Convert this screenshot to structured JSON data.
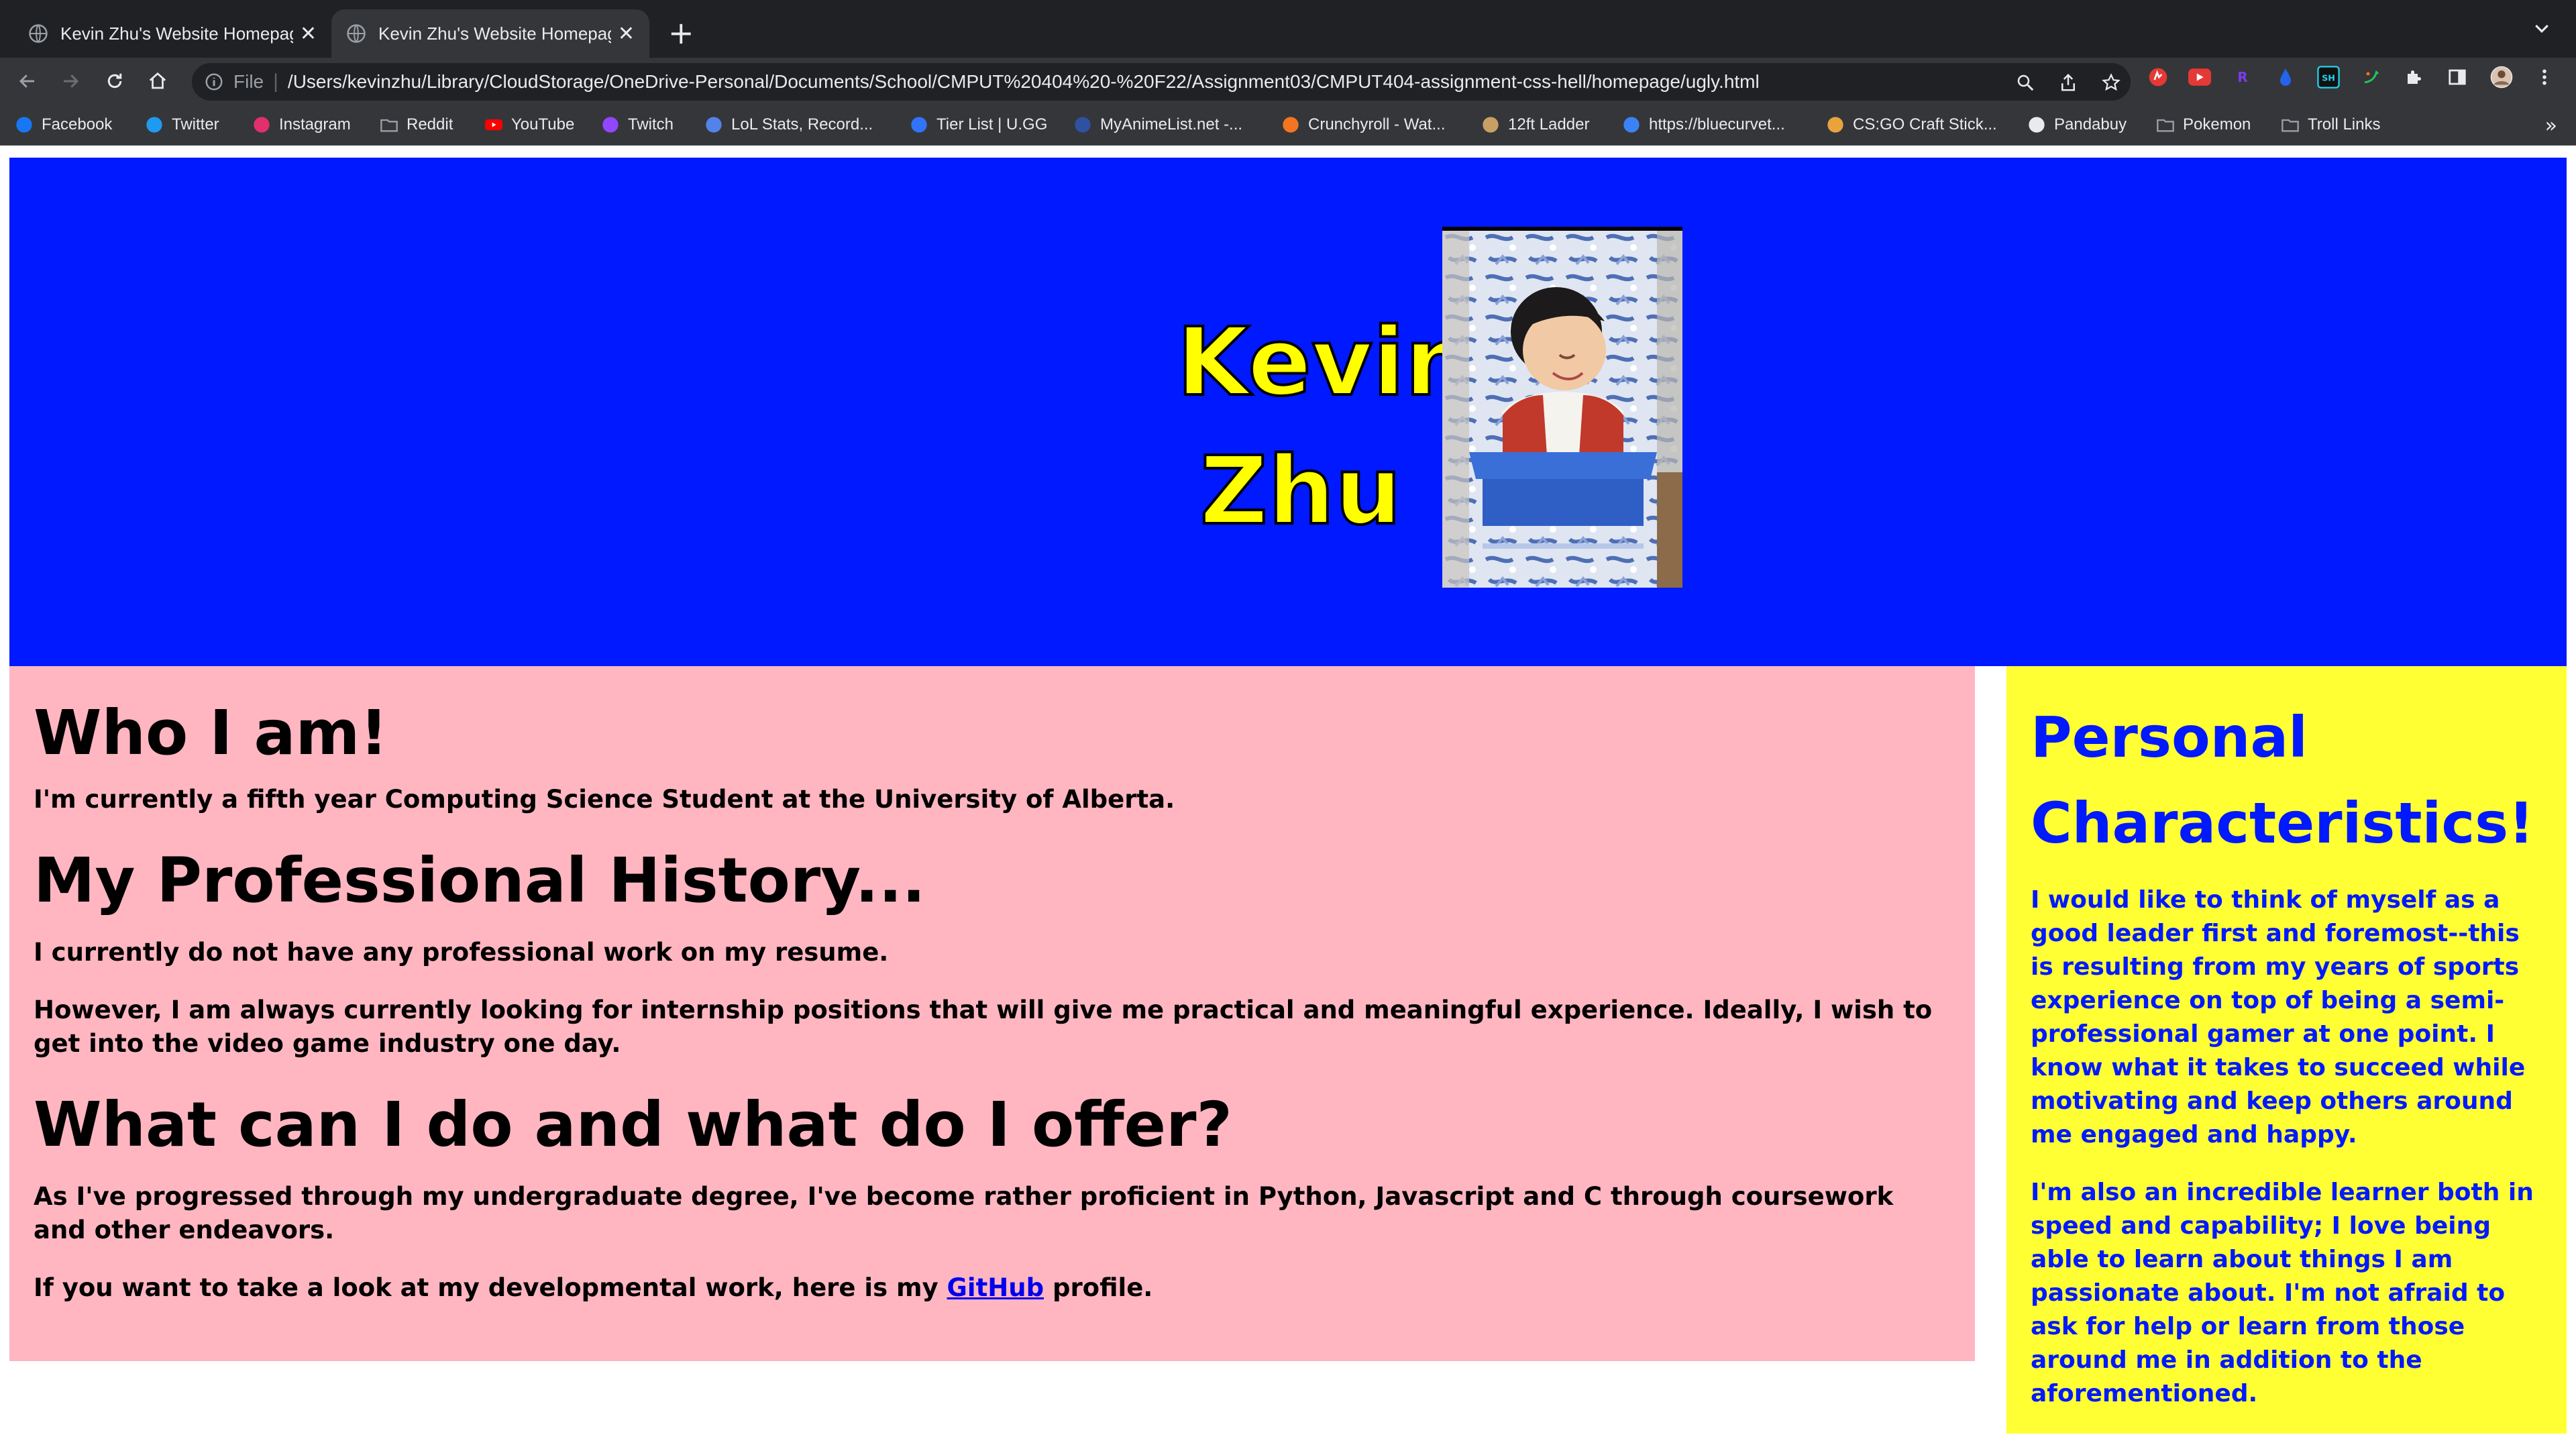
{
  "browser": {
    "tabs": [
      {
        "title": "Kevin Zhu's Website Homepage",
        "active": false
      },
      {
        "title": "Kevin Zhu's Website Homepage",
        "active": true
      }
    ],
    "address_bar": {
      "scheme_label": "File",
      "url": "/Users/kevinzhu/Library/CloudStorage/OneDrive-Personal/Documents/School/CMPUT%20404%20-%20F22/Assignment03/CMPUT404-assignment-css-hell/homepage/ugly.html"
    },
    "bookmarks": [
      {
        "label": "Facebook",
        "icon": "facebook-icon",
        "color": "#1877f2"
      },
      {
        "label": "Twitter",
        "icon": "twitter-icon",
        "color": "#1d9bf0"
      },
      {
        "label": "Instagram",
        "icon": "instagram-icon",
        "color": "#e1306c"
      },
      {
        "label": "Reddit",
        "icon": "folder-icon",
        "color": "#9aa0a6"
      },
      {
        "label": "YouTube",
        "icon": "youtube-icon",
        "color": "#ff0000"
      },
      {
        "label": "Twitch",
        "icon": "twitch-icon",
        "color": "#9146ff"
      },
      {
        "label": "LoL Stats, Record...",
        "icon": "opgg-icon",
        "color": "#5383e8"
      },
      {
        "label": "Tier List | U.GG",
        "icon": "ugg-icon",
        "color": "#3273fa"
      },
      {
        "label": "MyAnimeList.net -...",
        "icon": "mal-icon",
        "color": "#2e51a2"
      },
      {
        "label": "Crunchyroll - Wat...",
        "icon": "crunchyroll-icon",
        "color": "#f47521"
      },
      {
        "label": "12ft Ladder",
        "icon": "ladder-icon",
        "color": "#c8a064"
      },
      {
        "label": "https://bluecurvet...",
        "icon": "bluecurve-icon",
        "color": "#3b82f6"
      },
      {
        "label": "CS:GO Craft Stick...",
        "icon": "csgo-icon",
        "color": "#e8a33d"
      },
      {
        "label": "Pandabuy",
        "icon": "pandabuy-icon",
        "color": "#e8eaed"
      },
      {
        "label": "Pokemon",
        "icon": "folder-icon",
        "color": "#9aa0a6"
      },
      {
        "label": "Troll Links",
        "icon": "folder-icon",
        "color": "#9aa0a6"
      }
    ],
    "bookmarks_overflow": "»"
  },
  "page": {
    "banner": {
      "name_line1": "Kevin",
      "name_line2": "Zhu"
    },
    "main": {
      "heading_who": "Who I am!",
      "who_text": "I'm currently a fifth year Computing Science Student at the University of Alberta.",
      "heading_history": "My Professional History...",
      "history_text1": "I currently do not have any professional work on my resume.",
      "history_text2": "However, I am always currently looking for internship positions that will give me practical and meaningful experience. Ideally, I wish to get into the video game industry one day.",
      "heading_offer": "What can I do and what do I offer?",
      "offer_text": "As I've progressed through my undergraduate degree, I've become rather proficient in Python, Javascript and C through coursework and other endeavors.",
      "github_prefix": "If you want to take a look at my developmental work, here is my",
      "github_link": "GitHub",
      "github_suffix": "profile."
    },
    "sidebar": {
      "heading": "Personal Characteristics!",
      "para1": "I would like to think of myself as a good leader first and foremost--this is resulting from my years of sports experience on top of being a semi-professional gamer at one point. I know what it takes to succeed while motivating and keep others around me engaged and happy.",
      "para2": "I'm also an incredible learner both in speed and capability; I love being able to learn about things I am passionate about. I'm not afraid to ask for help or learn from those around me in addition to the aforementioned."
    },
    "colors": {
      "banner": "#0019ff",
      "name_text": "#ffff00",
      "main_bg": "#ffb6c1",
      "sidebar_bg": "#ffff33",
      "sidebar_text": "#0019ff"
    }
  }
}
